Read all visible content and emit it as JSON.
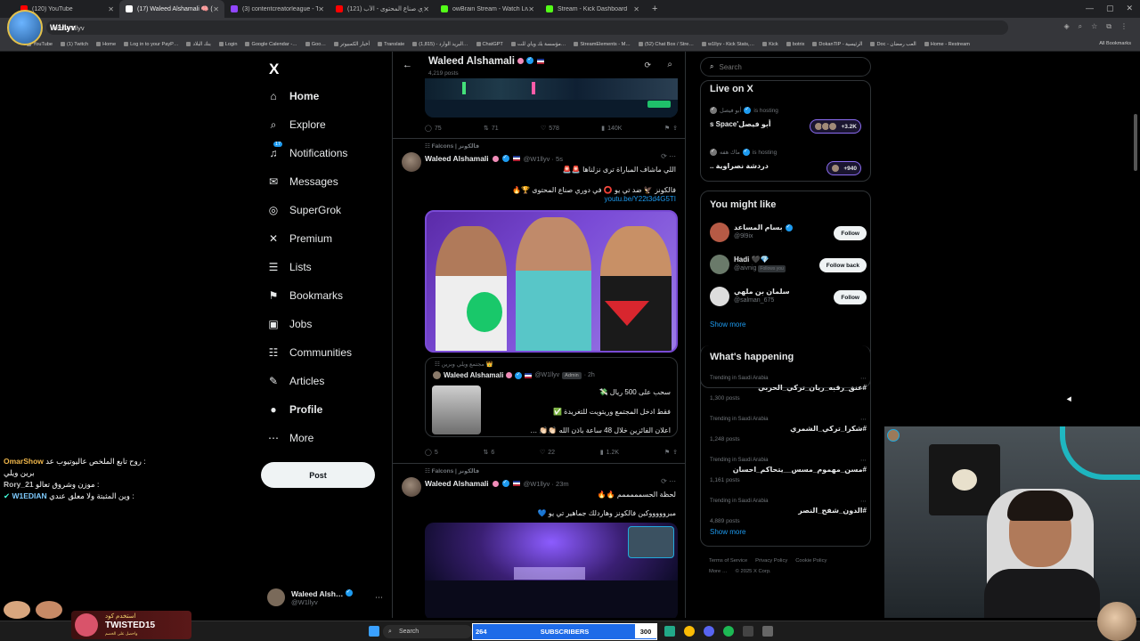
{
  "browser": {
    "tabs": [
      {
        "label": "(120) YouTube",
        "color": "#ff0000"
      },
      {
        "label": "(17) Waleed Alshamali 🧠 (@W…",
        "color": "#ffffff"
      },
      {
        "label": "(3) contentcreatorleague - Twit…",
        "color": "#9146ff"
      },
      {
        "label": "(121) دوري صناع المحتوى - الأب…",
        "color": "#ff0000"
      },
      {
        "label": "owBrain Stream - Watch Live o…",
        "color": "#53fc18"
      },
      {
        "label": "Stream - Kick Dashboard",
        "color": "#53fc18"
      }
    ],
    "new_tab": "+",
    "url": "om/W1llyv",
    "bookmarks": [
      "YouTube",
      "(1) Twitch",
      "Home",
      "Log in to your PayP…",
      "بنك البلاد",
      "Login",
      "Google Calendar -…",
      "Goo…",
      "أخبار الكمبيوتر",
      "Translate",
      "البريد الوارد - (1,815)…",
      "ChatGPT",
      "مؤسسة بك وياي للت…",
      "StreamElements - M…",
      "(52) Chat Box / Stre…",
      "w1llyv - Kick Stats,…",
      "Kick",
      "botrix",
      "DokanTIP - الرئيسية",
      "Doc - العب رمضان",
      "Home - Restream"
    ],
    "all_bookmarks": "All Bookmarks"
  },
  "overlay": {
    "channel_name": "W1llyv",
    "promo": {
      "line1": "استخدم كود",
      "code": "TWISTED15",
      "line3": "واحصل على الخصم"
    },
    "subscribers": {
      "count": "264",
      "label": "SUBSCRIBERS",
      "goal": "300"
    },
    "chat": [
      {
        "user": "OmarShow",
        "text": "روح تابع الملخص عاليوتيوب عد :"
      },
      {
        "user": "",
        "text": "برين ويلي"
      },
      {
        "user": "Rory_21",
        "text": "موزن وشروق تعالو :"
      },
      {
        "user": "W1EDIAN",
        "text": "وين المثبتة ولا معلق عندي :"
      }
    ]
  },
  "nav": {
    "logo": "X",
    "items": [
      {
        "label": "Home",
        "icon": "house-icon"
      },
      {
        "label": "Explore",
        "icon": "search-icon"
      },
      {
        "label": "Notifications",
        "icon": "bell-icon",
        "badge": "17"
      },
      {
        "label": "Messages",
        "icon": "envelope-icon"
      },
      {
        "label": "SuperGrok",
        "icon": "grok-icon"
      },
      {
        "label": "Premium",
        "icon": "x-icon"
      },
      {
        "label": "Lists",
        "icon": "list-icon"
      },
      {
        "label": "Bookmarks",
        "icon": "bookmark-icon"
      },
      {
        "label": "Jobs",
        "icon": "briefcase-icon"
      },
      {
        "label": "Communities",
        "icon": "people-icon"
      },
      {
        "label": "Articles",
        "icon": "article-icon"
      },
      {
        "label": "Profile",
        "icon": "person-icon"
      },
      {
        "label": "More",
        "icon": "more-icon"
      }
    ],
    "post_label": "Post",
    "account": {
      "name": "Waleed Alsh…",
      "handle": "@W1llyv"
    }
  },
  "timeline": {
    "header": {
      "name": "Waleed Alshamali",
      "sub": "4,219 posts"
    },
    "top_actions": {
      "replies": "75",
      "reposts": "71",
      "likes": "578",
      "views": "140K"
    },
    "tweet1": {
      "community": "Falcons | فالكونز",
      "name": "Waleed Alshamali",
      "handle": "@W1llyv · 5s",
      "line1": "اللي ماشاف المباراة ترى نزلناها 🚨🚨",
      "line2": "فالكونز 🦅 ضد تي يو ⭕ في دوري صناع المحتوى 🏆🔥",
      "link": "youtu.be/Y22t3d4G5TI",
      "quote": {
        "community": "مجتمع ويلي وبرين 👑",
        "name": "Waleed Alshamali",
        "handle": "@W1llyv",
        "badge": "Admin",
        "time": "· 2h",
        "l1": "سحب على 500 ريال 💸",
        "l2": "فقط ادخل المجتمع وريتويت للتغريدة ✅",
        "l3": "اعلان الفائزين خلال 48 ساعة باذن الله 👏🏻👏🏻 …"
      },
      "actions": {
        "replies": "5",
        "reposts": "6",
        "likes": "22",
        "views": "1.2K"
      }
    },
    "tweet2": {
      "community": "Falcons | فالكونز",
      "name": "Waleed Alshamali",
      "handle": "@W1llyv · 23m",
      "line1": "لحظة الحسمممممم 🔥🔥",
      "line2": "مبروووووكين فالكونز وهاردلك جماهير تي يو 💙"
    }
  },
  "sidebar": {
    "search_placeholder": "Search",
    "live": {
      "title": "Live on X",
      "items": [
        {
          "host": "أبو فيصل",
          "hosting": "is hosting",
          "title": "أبو فيصل's Space",
          "count": "+3.2K"
        },
        {
          "host": "ماك هفه",
          "hosting": "is hosting",
          "title": "دردشة نصراوية ..",
          "count": "+940"
        }
      ]
    },
    "wtf": {
      "title": "You might like",
      "items": [
        {
          "name": "بسام المساعد",
          "handle": "@9l9ix",
          "button": "Follow",
          "follows_you": ""
        },
        {
          "name": "Hadi 🖤💎",
          "handle": "@aivnig",
          "button": "Follow back",
          "follows_you": "Follows you"
        },
        {
          "name": "سلمان بن ملهي",
          "handle": "@salman_675",
          "button": "Follow",
          "follows_you": ""
        }
      ],
      "show_more": "Show more"
    },
    "trends": {
      "title": "What's happening",
      "items": [
        {
          "context": "Trending in Saudi Arabia",
          "tag": "#عنق_رقبه_ريان_تركي_الحربي",
          "count": "1,300 posts"
        },
        {
          "context": "Trending in Saudi Arabia",
          "tag": "#شكرا_تركي_الشمري",
          "count": "1,248 posts"
        },
        {
          "context": "Trending in Saudi Arabia",
          "tag": "#مسن_مهموم_مسس__يتحاكم_احسان",
          "count": "1,161 posts"
        },
        {
          "context": "Trending in Saudi Arabia",
          "tag": "#الدون_شفح_النصر",
          "count": "4,889 posts"
        }
      ],
      "show_more": "Show more"
    },
    "footer": {
      "links": [
        "Terms of Service",
        "Privacy Policy",
        "Cookie Policy"
      ],
      "more": "More …",
      "copyright": "© 2025 X Corp."
    }
  },
  "taskbar": {
    "search": "Search"
  }
}
